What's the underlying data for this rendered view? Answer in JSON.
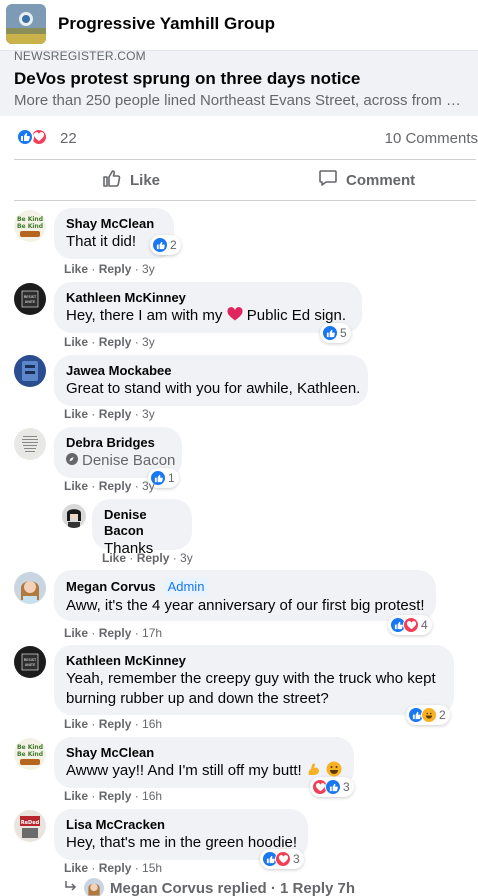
{
  "group": {
    "name": "Progressive Yamhill Group"
  },
  "link": {
    "domain": "NEWSREGISTER.COM",
    "title": "DeVos protest sprung on three days notice",
    "description": "More than 250 people lined Northeast Evans Street, across from M..."
  },
  "reactions": {
    "count": "22",
    "comments": "10 Comments"
  },
  "actions": {
    "like": "Like",
    "comment": "Comment"
  },
  "comments": [
    {
      "name": "Shay McClean",
      "text": "That it did!",
      "like": "Like",
      "reply": "Reply",
      "time": "3y",
      "reactions": "2"
    },
    {
      "name": "Kathleen McKinney",
      "text_before": "Hey, there I am with my",
      "text_after": "Public Ed sign.",
      "like": "Like",
      "reply": "Reply",
      "time": "3y",
      "reactions": "5"
    },
    {
      "name": "Jawea Mockabee",
      "text": "Great to stand with you for awhile, Kathleen.",
      "like": "Like",
      "reply": "Reply",
      "time": "3y"
    },
    {
      "name": "Debra Bridges",
      "tag": "Denise Bacon",
      "like": "Like",
      "reply": "Reply",
      "time": "3y",
      "reactions": "1"
    },
    {
      "name": "Denise Bacon",
      "text": "Thanks",
      "like": "Like",
      "reply": "Reply",
      "time": "3y"
    },
    {
      "name": "Megan Corvus",
      "badge": "Admin",
      "text": "Aww, it's the 4 year anniversary of our first big protest!",
      "like": "Like",
      "reply": "Reply",
      "time": "17h",
      "reactions": "4"
    },
    {
      "name": "Kathleen McKinney",
      "text_line1": "Yeah, remember the creepy guy with the truck who kept",
      "text_line2": "burning rubber up and down the street?",
      "like": "Like",
      "reply": "Reply",
      "time": "16h",
      "reactions": "2"
    },
    {
      "name": "Shay McClean",
      "text": "Awww yay!! And I'm still off my butt!",
      "like": "Like",
      "reply": "Reply",
      "time": "16h",
      "reactions": "3"
    },
    {
      "name": "Lisa McCracken",
      "text": "Hey, that's me in the green hoodie!",
      "like": "Like",
      "reply": "Reply",
      "time": "15h",
      "reactions": "3"
    }
  ],
  "replied": {
    "text": "Megan Corvus replied · 1 Reply 7h"
  },
  "colors": {
    "like_blue": "#1877f2",
    "love_red": "#f33e58",
    "bubble": "#f0f2f5",
    "meta": "#65676b"
  }
}
